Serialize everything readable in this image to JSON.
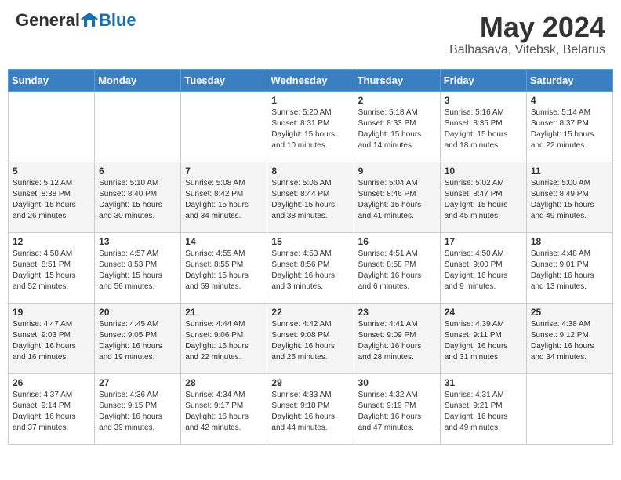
{
  "logo": {
    "general": "General",
    "blue": "Blue"
  },
  "title": "May 2024",
  "location": "Balbasava, Vitebsk, Belarus",
  "days_of_week": [
    "Sunday",
    "Monday",
    "Tuesday",
    "Wednesday",
    "Thursday",
    "Friday",
    "Saturday"
  ],
  "weeks": [
    [
      {
        "day": "",
        "info": ""
      },
      {
        "day": "",
        "info": ""
      },
      {
        "day": "",
        "info": ""
      },
      {
        "day": "1",
        "info": "Sunrise: 5:20 AM\nSunset: 8:31 PM\nDaylight: 15 hours\nand 10 minutes."
      },
      {
        "day": "2",
        "info": "Sunrise: 5:18 AM\nSunset: 8:33 PM\nDaylight: 15 hours\nand 14 minutes."
      },
      {
        "day": "3",
        "info": "Sunrise: 5:16 AM\nSunset: 8:35 PM\nDaylight: 15 hours\nand 18 minutes."
      },
      {
        "day": "4",
        "info": "Sunrise: 5:14 AM\nSunset: 8:37 PM\nDaylight: 15 hours\nand 22 minutes."
      }
    ],
    [
      {
        "day": "5",
        "info": "Sunrise: 5:12 AM\nSunset: 8:38 PM\nDaylight: 15 hours\nand 26 minutes."
      },
      {
        "day": "6",
        "info": "Sunrise: 5:10 AM\nSunset: 8:40 PM\nDaylight: 15 hours\nand 30 minutes."
      },
      {
        "day": "7",
        "info": "Sunrise: 5:08 AM\nSunset: 8:42 PM\nDaylight: 15 hours\nand 34 minutes."
      },
      {
        "day": "8",
        "info": "Sunrise: 5:06 AM\nSunset: 8:44 PM\nDaylight: 15 hours\nand 38 minutes."
      },
      {
        "day": "9",
        "info": "Sunrise: 5:04 AM\nSunset: 8:46 PM\nDaylight: 15 hours\nand 41 minutes."
      },
      {
        "day": "10",
        "info": "Sunrise: 5:02 AM\nSunset: 8:47 PM\nDaylight: 15 hours\nand 45 minutes."
      },
      {
        "day": "11",
        "info": "Sunrise: 5:00 AM\nSunset: 8:49 PM\nDaylight: 15 hours\nand 49 minutes."
      }
    ],
    [
      {
        "day": "12",
        "info": "Sunrise: 4:58 AM\nSunset: 8:51 PM\nDaylight: 15 hours\nand 52 minutes."
      },
      {
        "day": "13",
        "info": "Sunrise: 4:57 AM\nSunset: 8:53 PM\nDaylight: 15 hours\nand 56 minutes."
      },
      {
        "day": "14",
        "info": "Sunrise: 4:55 AM\nSunset: 8:55 PM\nDaylight: 15 hours\nand 59 minutes."
      },
      {
        "day": "15",
        "info": "Sunrise: 4:53 AM\nSunset: 8:56 PM\nDaylight: 16 hours\nand 3 minutes."
      },
      {
        "day": "16",
        "info": "Sunrise: 4:51 AM\nSunset: 8:58 PM\nDaylight: 16 hours\nand 6 minutes."
      },
      {
        "day": "17",
        "info": "Sunrise: 4:50 AM\nSunset: 9:00 PM\nDaylight: 16 hours\nand 9 minutes."
      },
      {
        "day": "18",
        "info": "Sunrise: 4:48 AM\nSunset: 9:01 PM\nDaylight: 16 hours\nand 13 minutes."
      }
    ],
    [
      {
        "day": "19",
        "info": "Sunrise: 4:47 AM\nSunset: 9:03 PM\nDaylight: 16 hours\nand 16 minutes."
      },
      {
        "day": "20",
        "info": "Sunrise: 4:45 AM\nSunset: 9:05 PM\nDaylight: 16 hours\nand 19 minutes."
      },
      {
        "day": "21",
        "info": "Sunrise: 4:44 AM\nSunset: 9:06 PM\nDaylight: 16 hours\nand 22 minutes."
      },
      {
        "day": "22",
        "info": "Sunrise: 4:42 AM\nSunset: 9:08 PM\nDaylight: 16 hours\nand 25 minutes."
      },
      {
        "day": "23",
        "info": "Sunrise: 4:41 AM\nSunset: 9:09 PM\nDaylight: 16 hours\nand 28 minutes."
      },
      {
        "day": "24",
        "info": "Sunrise: 4:39 AM\nSunset: 9:11 PM\nDaylight: 16 hours\nand 31 minutes."
      },
      {
        "day": "25",
        "info": "Sunrise: 4:38 AM\nSunset: 9:12 PM\nDaylight: 16 hours\nand 34 minutes."
      }
    ],
    [
      {
        "day": "26",
        "info": "Sunrise: 4:37 AM\nSunset: 9:14 PM\nDaylight: 16 hours\nand 37 minutes."
      },
      {
        "day": "27",
        "info": "Sunrise: 4:36 AM\nSunset: 9:15 PM\nDaylight: 16 hours\nand 39 minutes."
      },
      {
        "day": "28",
        "info": "Sunrise: 4:34 AM\nSunset: 9:17 PM\nDaylight: 16 hours\nand 42 minutes."
      },
      {
        "day": "29",
        "info": "Sunrise: 4:33 AM\nSunset: 9:18 PM\nDaylight: 16 hours\nand 44 minutes."
      },
      {
        "day": "30",
        "info": "Sunrise: 4:32 AM\nSunset: 9:19 PM\nDaylight: 16 hours\nand 47 minutes."
      },
      {
        "day": "31",
        "info": "Sunrise: 4:31 AM\nSunset: 9:21 PM\nDaylight: 16 hours\nand 49 minutes."
      },
      {
        "day": "",
        "info": ""
      }
    ]
  ]
}
